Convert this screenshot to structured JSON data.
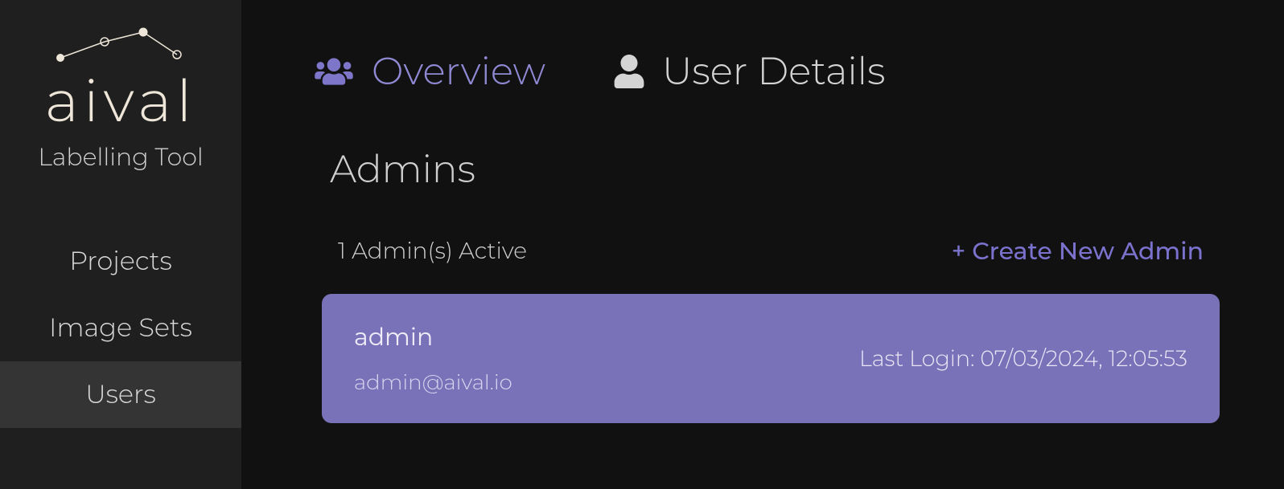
{
  "brand": {
    "name": "aival",
    "subtitle": "Labelling Tool"
  },
  "sidebar": {
    "items": [
      {
        "label": "Projects",
        "active": false
      },
      {
        "label": "Image Sets",
        "active": false
      },
      {
        "label": "Users",
        "active": true
      }
    ]
  },
  "tabs": [
    {
      "label": "Overview",
      "active": true
    },
    {
      "label": "User Details",
      "active": false
    }
  ],
  "section": {
    "title": "Admins",
    "active_count": "1 Admin(s) Active",
    "create_label": "+ Create New Admin"
  },
  "users": [
    {
      "name": "admin",
      "email": "admin@aival.io",
      "last_login": "Last Login: 07/03/2024, 12:05:53"
    }
  ]
}
